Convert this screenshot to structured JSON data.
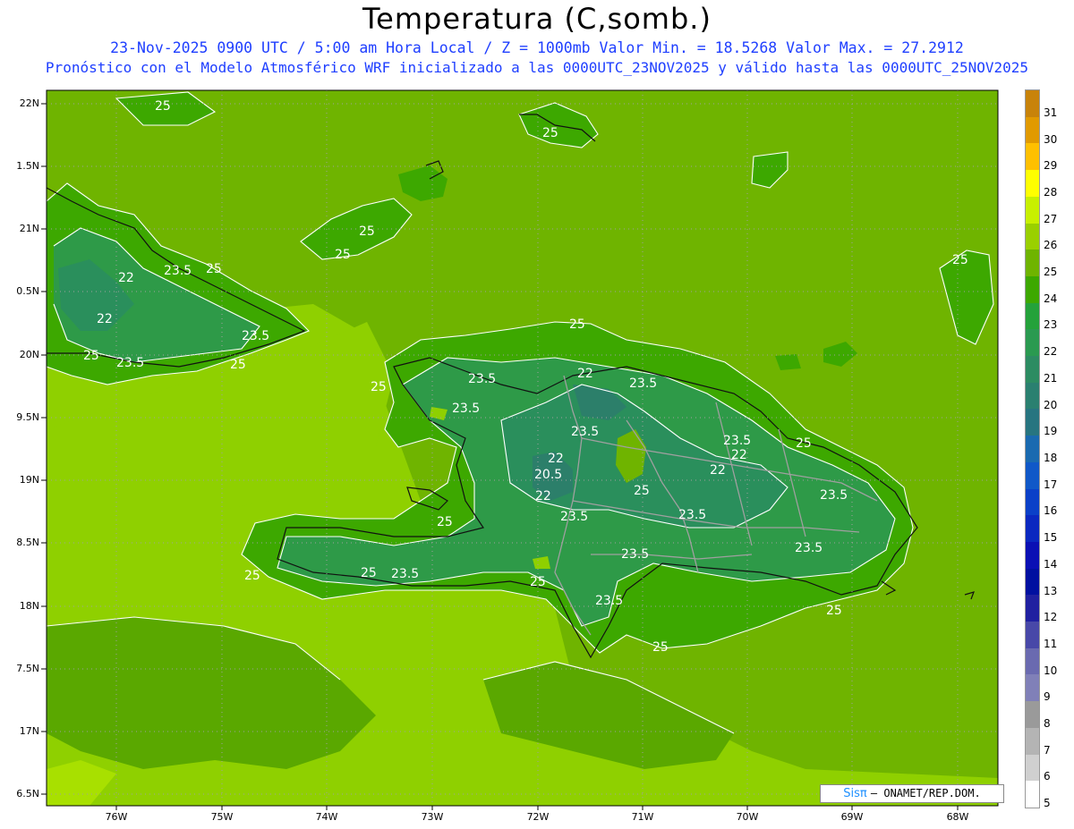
{
  "title": "Temperatura (C,somb.)",
  "subtitle_line1": "23-Nov-2025  0900 UTC / 5:00 am Hora Local / Z = 1000mb   Valor Min. = 18.5268  Valor Max. = 27.2912",
  "subtitle_line2": "Pronóstico con el Modelo Atmosférico WRF inicializado a las 0000UTC_23NOV2025 y válido hasta las  0000UTC_25NOV2025",
  "lat_labels": [
    "22N",
    "1.5N",
    "21N",
    "0.5N",
    "20N",
    "9.5N",
    "19N",
    "8.5N",
    "18N",
    "7.5N",
    "17N",
    "6.5N"
  ],
  "lon_labels": [
    "76W",
    "75W",
    "74W",
    "73W",
    "72W",
    "71W",
    "70W",
    "69W",
    "68W"
  ],
  "legend": {
    "values": [
      "31",
      "30",
      "29",
      "28",
      "27",
      "26",
      "25",
      "24",
      "23",
      "22",
      "21",
      "20",
      "19",
      "18",
      "17",
      "16",
      "15",
      "14",
      "13",
      "12",
      "11",
      "10",
      "9",
      "8",
      "7",
      "6",
      "5"
    ],
    "colors": [
      "#c8830a",
      "#e19a00",
      "#ffc000",
      "#ffff00",
      "#c8f000",
      "#9ad000",
      "#6fb400",
      "#3da800",
      "#24a23a",
      "#2a9a50",
      "#2c8c62",
      "#2a8070",
      "#277580",
      "#1a6ab0",
      "#1058c8",
      "#0a40c8",
      "#0a28c0",
      "#0a10b4",
      "#0010a0",
      "#2020a0",
      "#4848a8",
      "#6a6ab0",
      "#8080b8",
      "#9a9a9a",
      "#b4b4b4",
      "#d0d0d0",
      "#ffffff"
    ]
  },
  "contour_labels": [
    "25",
    "25",
    "25",
    "25",
    "25",
    "25",
    "22",
    "23.5",
    "25",
    "22",
    "23.5",
    "25",
    "25",
    "23.5",
    "23.5",
    "22",
    "23.5",
    "23.5",
    "25",
    "23.5",
    "22",
    "20.5",
    "22",
    "23.5",
    "25",
    "23.5",
    "22",
    "22",
    "23.5",
    "23.5",
    "23.5",
    "23.5",
    "25",
    "25",
    "23.5",
    "25",
    "25",
    "25",
    "25"
  ],
  "credit": {
    "brand": "Sisπ",
    "org": "– ONAMET/REP.DOM."
  }
}
